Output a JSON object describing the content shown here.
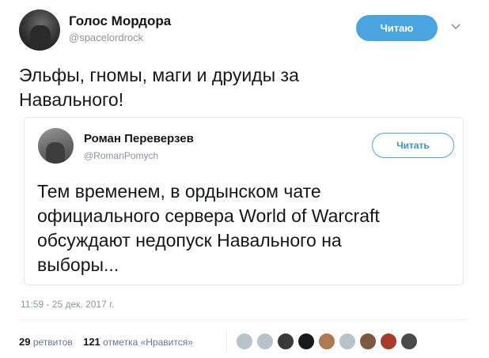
{
  "tweet": {
    "author_name": "Голос Мордора",
    "author_handle": "@spacelordrock",
    "follow_label": "Читаю",
    "text_line1": "Эльфы, гномы, маги и друиды за",
    "text_line2": "Навального!",
    "timestamp": "11:59 - 25 дек. 2017 г."
  },
  "quoted": {
    "author_name": "Роман Переверзев",
    "author_handle": "@RomanPomych",
    "follow_label": "Читать",
    "text_line1": "Тем временем, в ордынском чате",
    "text_line2": "официального сервера World of Warcraft",
    "text_line3": "обсуждают недопуск Навального на",
    "text_line4": "выборы..."
  },
  "stats": {
    "retweets_count": "29",
    "retweets_label": "ретвитов",
    "likes_count": "121",
    "likes_label": "отметка «Нравится»"
  },
  "likers": [
    {
      "color": "#b9c3ca"
    },
    {
      "color": "#b9c3ca"
    },
    {
      "color": "#3a3a3a"
    },
    {
      "color": "#1a1a1a"
    },
    {
      "color": "#b07850"
    },
    {
      "color": "#b9c3ca"
    },
    {
      "color": "#7a5a40"
    },
    {
      "color": "#a83a2a"
    },
    {
      "color": "#4a4a4a"
    }
  ]
}
